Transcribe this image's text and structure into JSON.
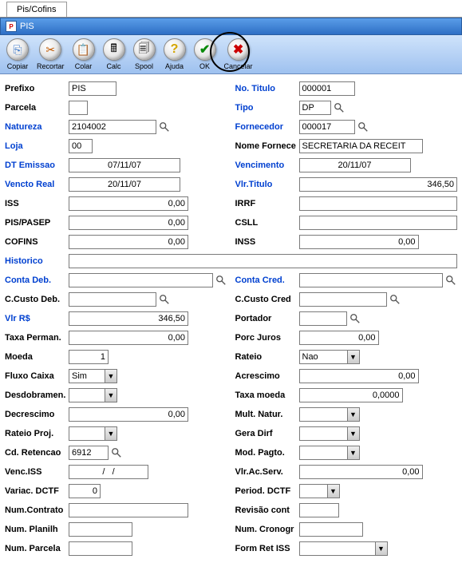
{
  "tab": {
    "label": "Pis/Cofins"
  },
  "window": {
    "title": "PIS"
  },
  "toolbar": {
    "copiar": "Copiar",
    "recortar": "Recortar",
    "colar": "Colar",
    "calc": "Calc",
    "spool": "Spool",
    "ajuda": "Ajuda",
    "ok": "OK",
    "cancelar": "Cancelar"
  },
  "fields": {
    "prefixo": {
      "label": "Prefixo",
      "value": "PIS"
    },
    "no_titulo": {
      "label": "No. Titulo",
      "value": "000001"
    },
    "parcela": {
      "label": "Parcela",
      "value": ""
    },
    "tipo": {
      "label": "Tipo",
      "value": "DP"
    },
    "natureza": {
      "label": "Natureza",
      "value": "2104002"
    },
    "fornecedor": {
      "label": "Fornecedor",
      "value": "000017"
    },
    "loja": {
      "label": "Loja",
      "value": "00"
    },
    "nome_fornece": {
      "label": "Nome Fornece",
      "value": "SECRETARIA DA RECEIT"
    },
    "dt_emissao": {
      "label": "DT Emissao",
      "value": "07/11/07"
    },
    "vencimento": {
      "label": "Vencimento",
      "value": "20/11/07"
    },
    "vencto_real": {
      "label": "Vencto Real",
      "value": "20/11/07"
    },
    "vlr_titulo": {
      "label": "Vlr.Titulo",
      "value": "346,50"
    },
    "iss": {
      "label": "ISS",
      "value": "0,00"
    },
    "irrf": {
      "label": "IRRF",
      "value": ""
    },
    "pis_pasep": {
      "label": "PIS/PASEP",
      "value": "0,00"
    },
    "csll": {
      "label": "CSLL",
      "value": ""
    },
    "cofins": {
      "label": "COFINS",
      "value": "0,00"
    },
    "inss": {
      "label": "INSS",
      "value": "0,00"
    },
    "historico": {
      "label": "Historico",
      "value": ""
    },
    "conta_deb": {
      "label": "Conta Deb.",
      "value": ""
    },
    "conta_cred": {
      "label": "Conta Cred.",
      "value": ""
    },
    "ccusto_deb": {
      "label": "C.Custo Deb.",
      "value": ""
    },
    "ccusto_cred": {
      "label": "C.Custo Cred",
      "value": ""
    },
    "vlr_rs": {
      "label": "Vlr R$",
      "value": "346,50"
    },
    "portador": {
      "label": "Portador",
      "value": ""
    },
    "taxa_perman": {
      "label": "Taxa Perman.",
      "value": "0,00"
    },
    "porc_juros": {
      "label": "Porc Juros",
      "value": "0,00"
    },
    "moeda": {
      "label": "Moeda",
      "value": "1"
    },
    "rateio": {
      "label": "Rateio",
      "value": "Nao"
    },
    "fluxo_caixa": {
      "label": "Fluxo Caixa",
      "value": "Sim"
    },
    "acrescimo": {
      "label": "Acrescimo",
      "value": "0,00"
    },
    "desdobramen": {
      "label": "Desdobramen.",
      "value": ""
    },
    "taxa_moeda": {
      "label": "Taxa moeda",
      "value": "0,0000"
    },
    "decrescimo": {
      "label": "Decrescimo",
      "value": "0,00"
    },
    "mult_natur": {
      "label": "Mult. Natur.",
      "value": ""
    },
    "rateio_proj": {
      "label": "Rateio Proj.",
      "value": ""
    },
    "gera_dirf": {
      "label": "Gera Dirf",
      "value": ""
    },
    "cd_retencao": {
      "label": "Cd. Retencao",
      "value": "6912"
    },
    "mod_pagto": {
      "label": "Mod. Pagto.",
      "value": ""
    },
    "venc_iss": {
      "label": "Venc.ISS",
      "value": "/   /"
    },
    "vlr_ac_serv": {
      "label": "Vlr.Ac.Serv.",
      "value": "0,00"
    },
    "variac_dctf": {
      "label": "Variac. DCTF",
      "value": "0"
    },
    "period_dctf": {
      "label": "Period. DCTF",
      "value": ""
    },
    "num_contrato": {
      "label": "Num.Contrato",
      "value": ""
    },
    "revisao_cont": {
      "label": "Revisão cont",
      "value": ""
    },
    "num_planilh": {
      "label": "Num. Planilh",
      "value": ""
    },
    "num_cronogr": {
      "label": "Num. Cronogr",
      "value": ""
    },
    "num_parcela": {
      "label": "Num. Parcela",
      "value": ""
    },
    "form_ret_iss": {
      "label": "Form Ret ISS",
      "value": ""
    }
  }
}
